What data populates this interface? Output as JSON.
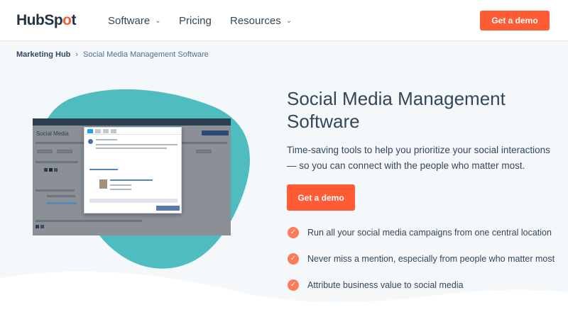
{
  "nav": {
    "logo": {
      "part1": "HubSp",
      "part2": "t"
    },
    "links": [
      {
        "label": "Software",
        "has_dropdown": true
      },
      {
        "label": "Pricing",
        "has_dropdown": false
      },
      {
        "label": "Resources",
        "has_dropdown": true
      }
    ],
    "cta_label": "Get a demo",
    "dropdown_icon": "chevron-down-icon"
  },
  "breadcrumb": {
    "parent": "Marketing Hub",
    "separator": "›",
    "current": "Social Media Management Software"
  },
  "hero": {
    "title": "Social Media Management Software",
    "description": "Time-saving tools to help you prioritize your social interactions — so you can connect with the people who matter most.",
    "cta_label": "Get a demo",
    "features": [
      "Run all your social media campaigns from one central location",
      "Never miss a mention, especially from people who matter most",
      "Attribute business value to social media"
    ],
    "feature_icon": "check-circle-icon"
  },
  "screenshot": {
    "app_title": "Social Media"
  },
  "colors": {
    "accent": "#ff5c35",
    "check": "#ff7a59",
    "blob": "#4fbdbf",
    "text": "#33475b",
    "background": "#f5f8fa"
  }
}
